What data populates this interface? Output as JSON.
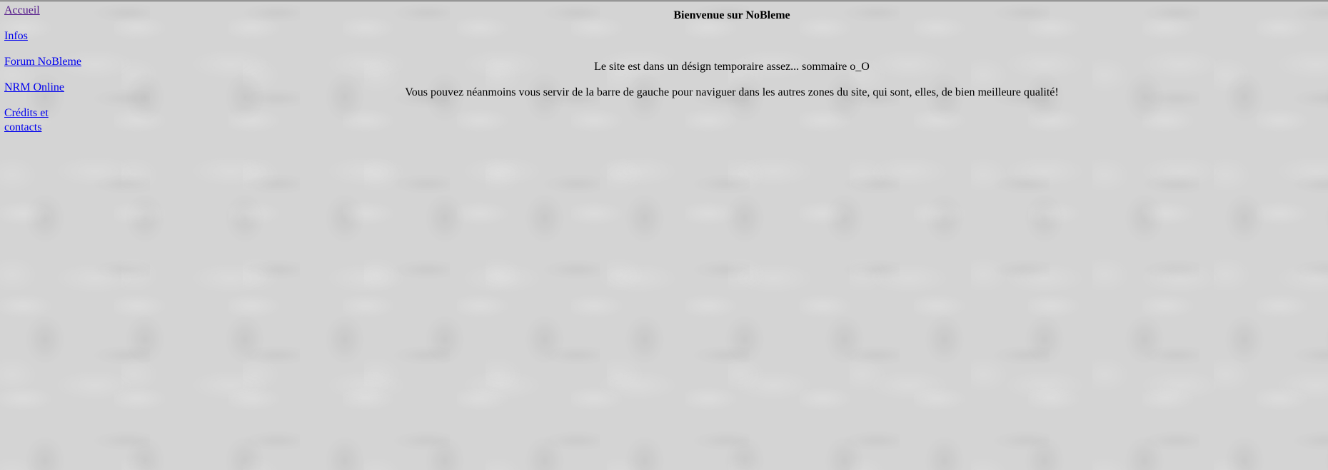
{
  "sidebar": {
    "items": [
      {
        "label": "Accueil"
      },
      {
        "label": "Infos"
      },
      {
        "label": "Forum NoBleme"
      },
      {
        "label": "NRM Online"
      },
      {
        "label": "Crédits et contacts"
      }
    ]
  },
  "main": {
    "title": "Bienvenue sur NoBleme",
    "intro": "Le site est dans un désign temporaire assez... sommaire o_O",
    "hint": "Vous pouvez néanmoins vous servir de la barre de gauche pour naviguer dans les autres zones du site, qui sont, elles, de bien meilleure qualité!"
  },
  "colors": {
    "link": "#0000ee",
    "visited_link": "#551a8b",
    "background": "#d4d4d4"
  }
}
